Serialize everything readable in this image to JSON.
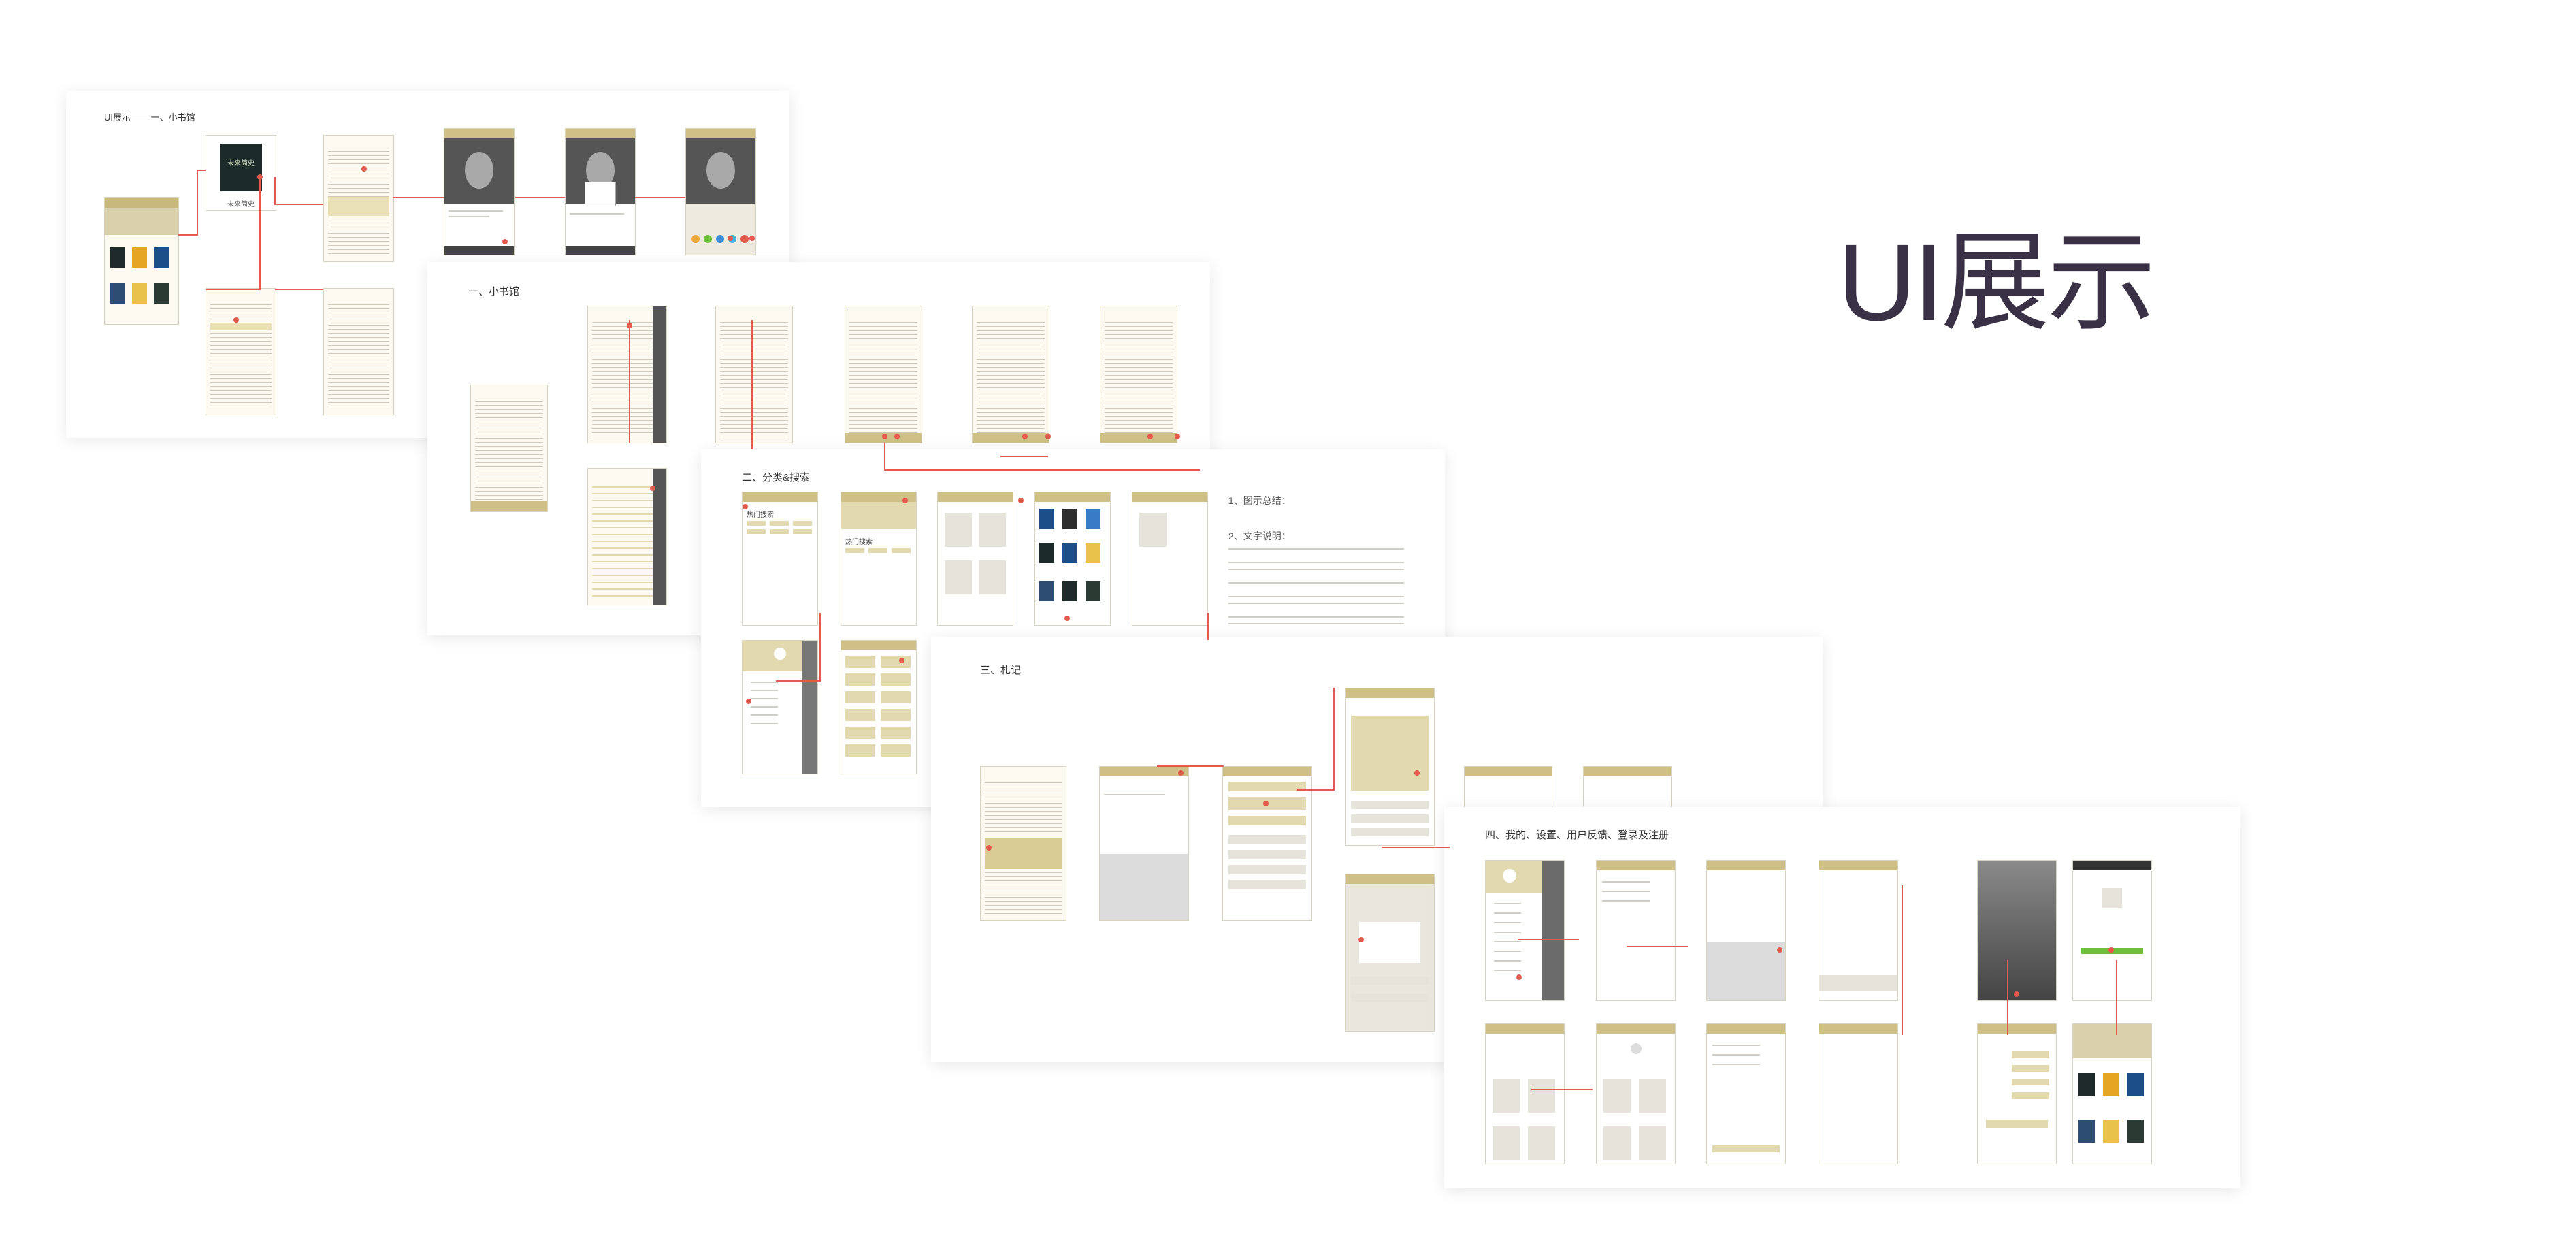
{
  "hero_title": "UI展示",
  "boards": {
    "b1": {
      "title": "UI展示—— 一、小书馆"
    },
    "b2": {
      "title": "一、小书馆"
    },
    "b3": {
      "title": "二、分类&搜索",
      "legend_title": "1、图示总结：",
      "text_title": "2、文字说明：",
      "popular_search": "热门搜索"
    },
    "b4": {
      "title": "三、札记"
    },
    "b5": {
      "title": "四、我的、设置、用户反馈、登录及注册"
    }
  },
  "book": {
    "cover_title": "未来简史"
  },
  "colors": {
    "accent": "#cfc088",
    "link": "#e45b4d",
    "hero": "#3a3146",
    "background": "#ffffff"
  }
}
